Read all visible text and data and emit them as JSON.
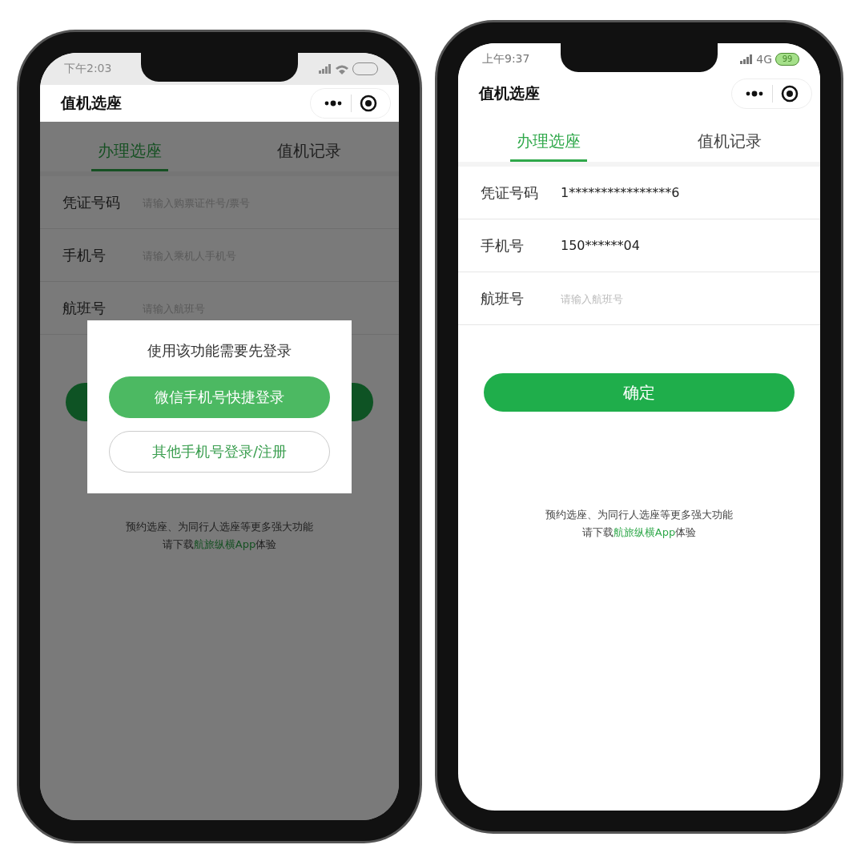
{
  "phones": [
    {
      "status_bar": {
        "time": "下午2:03",
        "wifi": true,
        "charging": false
      },
      "title": "值机选座",
      "tabs": [
        {
          "label": "办理选座",
          "selected": true
        },
        {
          "label": "值机记录",
          "selected": false
        }
      ],
      "fields": [
        {
          "label": "凭证号码",
          "placeholder": "请输入购票证件号/票号"
        },
        {
          "label": "手机号",
          "placeholder": "请输入乘机人手机号"
        },
        {
          "label": "航班号",
          "placeholder": "请输入航班号"
        }
      ],
      "note": {
        "line_1": "预约选座、为同行人选座等更多强大功能",
        "prefix": "请下载",
        "link": "航旅纵横App",
        "suffix": "体验"
      },
      "overlay": true,
      "dialog": {
        "message": "使用该功能需要先登录",
        "buttons": [
          {
            "label": "微信手机号快捷登录",
            "kind": "primary"
          },
          {
            "label": "其他手机号登录/注册",
            "kind": "secondary"
          }
        ]
      }
    },
    {
      "status_bar": {
        "time": "上午9:37",
        "network": "4G",
        "battery_text": "99",
        "wifi": false,
        "charging": true
      },
      "title": "值机选座",
      "tabs": [
        {
          "label": "办理选座",
          "selected": true
        },
        {
          "label": "值机记录",
          "selected": false
        }
      ],
      "fields": [
        {
          "label": "凭证号码",
          "value": "1****************6"
        },
        {
          "label": "手机号",
          "value": "150******04"
        },
        {
          "label": "航班号",
          "placeholder": "请输入航班号"
        }
      ],
      "confirm_button": {
        "label": "确定"
      },
      "note": {
        "line_1": "预约选座、为同行人选座等更多强大功能",
        "prefix": "请下载",
        "link": "航旅纵横App",
        "suffix": "体验"
      },
      "overlay": false
    }
  ]
}
